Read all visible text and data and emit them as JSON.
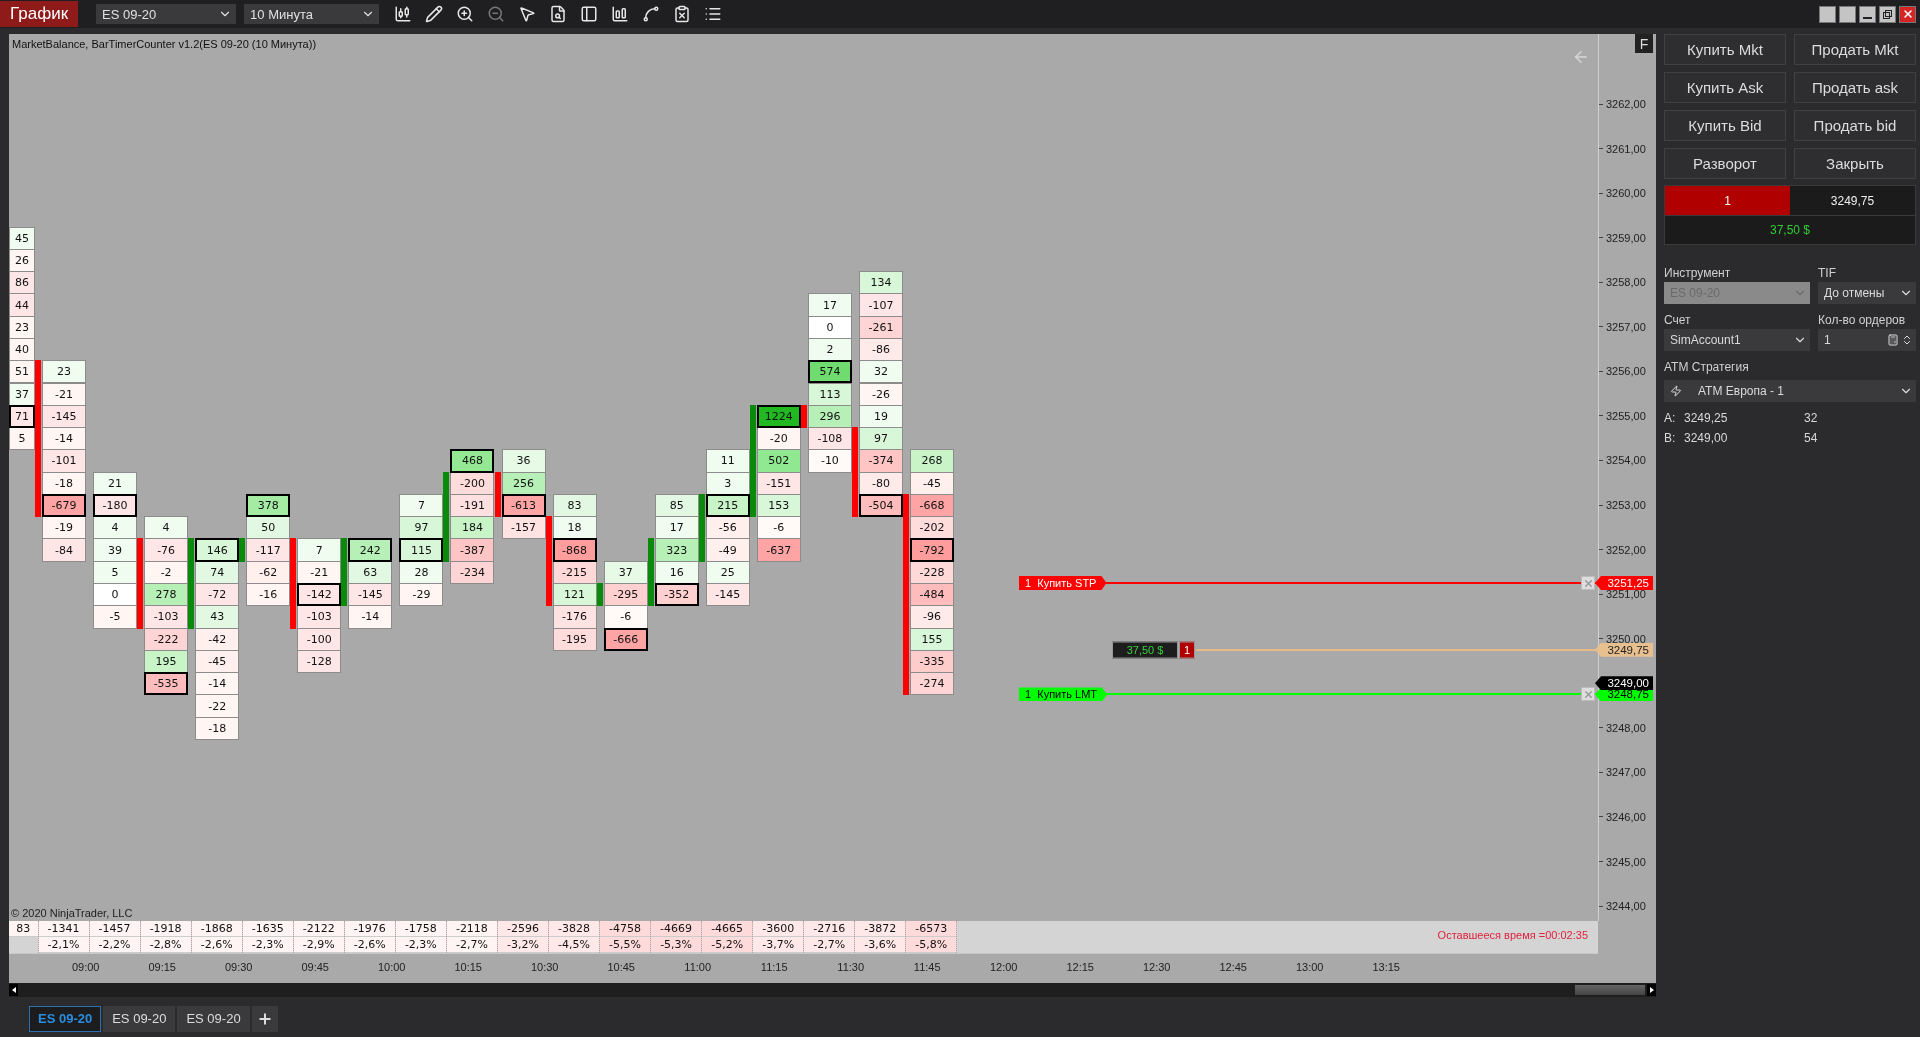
{
  "toolbar": {
    "title": "График",
    "instrument": "ES 09-20",
    "interval": "10 Минута"
  },
  "chart": {
    "indicator_label": "MarketBalance, BarTimerCounter v1.2(ES 09-20 (10 Минута))",
    "f_button": "F",
    "price_ticks": [
      "3262,00",
      "3261,00",
      "3260,00",
      "3259,00",
      "3258,00",
      "3257,00",
      "3256,00",
      "3255,00",
      "3254,00",
      "3253,00",
      "3252,00",
      "3251,00",
      "3250,00",
      "3248,00",
      "3247,00",
      "3246,00",
      "3245,00",
      "3244,00"
    ],
    "time_ticks": [
      "09:00",
      "09:15",
      "09:30",
      "09:45",
      "10:00",
      "10:15",
      "10:30",
      "10:45",
      "11:00",
      "11:15",
      "11:30",
      "11:45",
      "12:00",
      "12:15",
      "12:30",
      "12:45",
      "13:00",
      "13:15"
    ],
    "bars": [
      {
        "cells": [
          {
            "value": "45",
            "color": "#effcef",
            "max": false,
            "body": false
          },
          {
            "value": "26",
            "color": "#fff6f4",
            "max": false,
            "body": false
          },
          {
            "value": "86",
            "color": "#ffe6e6",
            "max": false,
            "body": false
          },
          {
            "value": "44",
            "color": "#ffe6e6",
            "max": false,
            "body": false
          },
          {
            "value": "23",
            "color": "#fff6f4",
            "max": false,
            "body": false
          },
          {
            "value": "40",
            "color": "#fff6f4",
            "max": false,
            "body": false
          },
          {
            "value": "51",
            "color": "#fff6f4",
            "max": false,
            "body": false
          },
          {
            "value": "37",
            "color": "#effcef",
            "max": false,
            "body": false
          },
          {
            "value": "71",
            "color": "#ffe6e6",
            "max": true,
            "body": false
          },
          {
            "value": "5",
            "color": "#fff6f4",
            "max": false,
            "body": false
          }
        ]
      },
      {
        "color": "#ff0000",
        "cells": [
          {
            "value": "23",
            "color": "#effcef",
            "max": false,
            "body": true
          },
          {
            "value": "-21",
            "color": "#fff6f4",
            "max": false,
            "body": true
          },
          {
            "value": "-145",
            "color": "#ffe6e6",
            "max": false,
            "body": true
          },
          {
            "value": "-14",
            "color": "#fff6f4",
            "max": false,
            "body": true
          },
          {
            "value": "-101",
            "color": "#ffe6e6",
            "max": false,
            "body": true
          },
          {
            "value": "-18",
            "color": "#fff6f4",
            "max": false,
            "body": true
          },
          {
            "value": "-679",
            "color": "#ffa4a4",
            "max": true,
            "body": true
          },
          {
            "value": "-19",
            "color": "#fff6f4",
            "max": false,
            "body": false
          },
          {
            "value": "-84",
            "color": "#ffe6e6",
            "max": false,
            "body": false
          }
        ]
      },
      {
        "cells": [
          {
            "value": "21",
            "color": "#effcef",
            "max": false,
            "body": false
          },
          {
            "value": "-180",
            "color": "#ffe6e6",
            "max": true,
            "body": false
          },
          {
            "value": "4",
            "color": "#effcef",
            "max": false,
            "body": false
          },
          {
            "value": "39",
            "color": "#effcef",
            "max": false,
            "body": false
          },
          {
            "value": "5",
            "color": "#effcef",
            "max": false,
            "body": false
          },
          {
            "value": "0",
            "color": "#ffffff",
            "max": false,
            "body": false
          },
          {
            "value": "-5",
            "color": "#fff6f4",
            "max": false,
            "body": false
          }
        ]
      },
      {
        "color": "#ff0000",
        "cells": [
          {
            "value": "4",
            "color": "#effcef",
            "max": false,
            "body": false
          },
          {
            "value": "-76",
            "color": "#ffe6e6",
            "max": false,
            "body": true
          },
          {
            "value": "-2",
            "color": "#fff6f4",
            "max": false,
            "body": true
          },
          {
            "value": "278",
            "color": "#b6f0b6",
            "max": false,
            "body": true
          },
          {
            "value": "-103",
            "color": "#ffe6e6",
            "max": false,
            "body": true
          },
          {
            "value": "-222",
            "color": "#ffd4d4",
            "max": false,
            "body": false
          },
          {
            "value": "195",
            "color": "#c8f4c8",
            "max": false,
            "body": false
          },
          {
            "value": "-535",
            "color": "#ffbcbc",
            "max": true,
            "body": false
          }
        ]
      },
      {
        "color": "#0a8a0a",
        "cells": [
          {
            "value": "146",
            "color": "#d8f6d8",
            "max": true,
            "body": true
          },
          {
            "value": "74",
            "color": "#e2f8e2",
            "max": false,
            "body": true
          },
          {
            "value": "-72",
            "color": "#ffe6e6",
            "max": false,
            "body": true
          },
          {
            "value": "43",
            "color": "#e2f8e2",
            "max": false,
            "body": true
          },
          {
            "value": "-42",
            "color": "#fff0ee",
            "max": false,
            "body": false
          },
          {
            "value": "-45",
            "color": "#fff0ee",
            "max": false,
            "body": false
          },
          {
            "value": "-14",
            "color": "#fff6f4",
            "max": false,
            "body": false
          },
          {
            "value": "-22",
            "color": "#fff6f4",
            "max": false,
            "body": false
          },
          {
            "value": "-18",
            "color": "#fff6f4",
            "max": false,
            "body": false
          }
        ]
      },
      {
        "color": "#0a8a0a",
        "cells": [
          {
            "value": "378",
            "color": "#a4eca4",
            "max": true,
            "body": false
          },
          {
            "value": "50",
            "color": "#e2f8e2",
            "max": false,
            "body": false
          },
          {
            "value": "-117",
            "color": "#ffe6e6",
            "max": false,
            "body": true
          },
          {
            "value": "-62",
            "color": "#fff0ee",
            "max": false,
            "body": false
          },
          {
            "value": "-16",
            "color": "#fff6f4",
            "max": false,
            "body": false
          }
        ]
      },
      {
        "color": "#ff0000",
        "cells": [
          {
            "value": "7",
            "color": "#effcef",
            "max": false,
            "body": true
          },
          {
            "value": "-21",
            "color": "#fff6f4",
            "max": false,
            "body": true
          },
          {
            "value": "-142",
            "color": "#ffe6e6",
            "max": true,
            "body": true
          },
          {
            "value": "-103",
            "color": "#ffe6e6",
            "max": false,
            "body": true
          },
          {
            "value": "-100",
            "color": "#ffe6e6",
            "max": false,
            "body": false
          },
          {
            "value": "-128",
            "color": "#ffe6e6",
            "max": false,
            "body": false
          }
        ]
      },
      {
        "color": "#0a8a0a",
        "cells": [
          {
            "value": "242",
            "color": "#b6f0b6",
            "max": true,
            "body": true
          },
          {
            "value": "63",
            "color": "#e2f8e2",
            "max": false,
            "body": true
          },
          {
            "value": "-145",
            "color": "#ffe6e6",
            "max": false,
            "body": true
          },
          {
            "value": "-14",
            "color": "#fff6f4",
            "max": false,
            "body": false
          }
        ]
      },
      {
        "cells": [
          {
            "value": "7",
            "color": "#effcef",
            "max": false,
            "body": false
          },
          {
            "value": "97",
            "color": "#d8f6d8",
            "max": false,
            "body": false
          },
          {
            "value": "115",
            "color": "#d8f6d8",
            "max": true,
            "body": false
          },
          {
            "value": "28",
            "color": "#effcef",
            "max": false,
            "body": false
          },
          {
            "value": "-29",
            "color": "#fff6f4",
            "max": false,
            "body": false
          }
        ]
      },
      {
        "color": "#0a8a0a",
        "cells": [
          {
            "value": "468",
            "color": "#94e894",
            "max": true,
            "body": false
          },
          {
            "value": "-200",
            "color": "#ffdcdc",
            "max": false,
            "body": true
          },
          {
            "value": "-191",
            "color": "#ffe0e0",
            "max": false,
            "body": true
          },
          {
            "value": "184",
            "color": "#c8f4c8",
            "max": false,
            "body": true
          },
          {
            "value": "-387",
            "color": "#ffc4c4",
            "max": false,
            "body": true
          },
          {
            "value": "-234",
            "color": "#ffd4d4",
            "max": false,
            "body": false
          }
        ]
      },
      {
        "color": "#ff0000",
        "cells": [
          {
            "value": "36",
            "color": "#e6fae6",
            "max": false,
            "body": false
          },
          {
            "value": "256",
            "color": "#b6f0b6",
            "max": false,
            "body": true
          },
          {
            "value": "-613",
            "color": "#ffa4a4",
            "max": true,
            "body": true
          },
          {
            "value": "-157",
            "color": "#ffe2e2",
            "max": false,
            "body": false
          }
        ]
      },
      {
        "color": "#ff0000",
        "cells": [
          {
            "value": "83",
            "color": "#e2f8e2",
            "max": false,
            "body": false
          },
          {
            "value": "18",
            "color": "#effcef",
            "max": false,
            "body": true
          },
          {
            "value": "-868",
            "color": "#ff9c9c",
            "max": true,
            "body": true
          },
          {
            "value": "-215",
            "color": "#ffd8d8",
            "max": false,
            "body": true
          },
          {
            "value": "121",
            "color": "#d8f6d8",
            "max": false,
            "body": true
          },
          {
            "value": "-176",
            "color": "#ffe2e2",
            "max": false,
            "body": false
          },
          {
            "value": "-195",
            "color": "#ffdcdc",
            "max": false,
            "body": false
          }
        ]
      },
      {
        "color": "#0a8a0a",
        "cells": [
          {
            "value": "37",
            "color": "#e6fae6",
            "max": false,
            "body": false
          },
          {
            "value": "-295",
            "color": "#ffd0d0",
            "max": false,
            "body": true
          },
          {
            "value": "-6",
            "color": "#fff9f8",
            "max": false,
            "body": false
          },
          {
            "value": "-666",
            "color": "#ffa4a4",
            "max": true,
            "body": false
          }
        ]
      },
      {
        "color": "#0a8a0a",
        "cells": [
          {
            "value": "85",
            "color": "#e2f8e2",
            "max": false,
            "body": false
          },
          {
            "value": "17",
            "color": "#effcef",
            "max": false,
            "body": false
          },
          {
            "value": "323",
            "color": "#b6f0b6",
            "max": false,
            "body": true
          },
          {
            "value": "16",
            "color": "#effcef",
            "max": false,
            "body": true
          },
          {
            "value": "-352",
            "color": "#ffd0d0",
            "max": true,
            "body": true
          }
        ]
      },
      {
        "color": "#0a8a0a",
        "cells": [
          {
            "value": "11",
            "color": "#effcef",
            "max": false,
            "body": false
          },
          {
            "value": "3",
            "color": "#effcef",
            "max": false,
            "body": false
          },
          {
            "value": "215",
            "color": "#c8f4c8",
            "max": true,
            "body": true
          },
          {
            "value": "-56",
            "color": "#fff0ee",
            "max": false,
            "body": true
          },
          {
            "value": "-49",
            "color": "#fff0ee",
            "max": false,
            "body": true
          },
          {
            "value": "25",
            "color": "#effcef",
            "max": false,
            "body": false
          },
          {
            "value": "-145",
            "color": "#ffe6e6",
            "max": false,
            "body": false
          }
        ]
      },
      {
        "color": "#0a8a0a",
        "cells": [
          {
            "value": "1224",
            "color": "#22b822",
            "max": true,
            "body": true
          },
          {
            "value": "-20",
            "color": "#fff6f4",
            "max": false,
            "body": true
          },
          {
            "value": "502",
            "color": "#90e890",
            "max": false,
            "body": true
          },
          {
            "value": "-151",
            "color": "#ffe6e6",
            "max": false,
            "body": true
          },
          {
            "value": "153",
            "color": "#d8f6d8",
            "max": false,
            "body": true
          },
          {
            "value": "-6",
            "color": "#fff9f8",
            "max": false,
            "body": false
          },
          {
            "value": "-637",
            "color": "#ffa4a4",
            "max": false,
            "body": false
          }
        ]
      },
      {
        "color": "#ff0000",
        "cells": [
          {
            "value": "17",
            "color": "#effcef",
            "max": false,
            "body": false
          },
          {
            "value": "0",
            "color": "#ffffff",
            "max": false,
            "body": false
          },
          {
            "value": "2",
            "color": "#effcef",
            "max": false,
            "body": false
          },
          {
            "value": "574",
            "color": "#70dc70",
            "max": true,
            "body": false
          },
          {
            "value": "113",
            "color": "#d8f6d8",
            "max": false,
            "body": false
          },
          {
            "value": "296",
            "color": "#b6f0b6",
            "max": false,
            "body": true
          },
          {
            "value": "-108",
            "color": "#ffe6e6",
            "max": false,
            "body": false
          },
          {
            "value": "-10",
            "color": "#fff9f8",
            "max": false,
            "body": false
          }
        ]
      },
      {
        "color": "#ff0000",
        "cells": [
          {
            "value": "134",
            "color": "#d8f6d8",
            "max": false,
            "body": false
          },
          {
            "value": "-107",
            "color": "#ffe6e6",
            "max": false,
            "body": false
          },
          {
            "value": "-261",
            "color": "#ffd4d4",
            "max": false,
            "body": false
          },
          {
            "value": "-86",
            "color": "#ffeaea",
            "max": false,
            "body": false
          },
          {
            "value": "32",
            "color": "#effcef",
            "max": false,
            "body": false
          },
          {
            "value": "-26",
            "color": "#fff6f4",
            "max": false,
            "body": false
          },
          {
            "value": "19",
            "color": "#effcef",
            "max": false,
            "body": false
          },
          {
            "value": "97",
            "color": "#d8f6d8",
            "max": false,
            "body": true
          },
          {
            "value": "-374",
            "color": "#ffc4c4",
            "max": false,
            "body": true
          },
          {
            "value": "-80",
            "color": "#ffeaea",
            "max": false,
            "body": true
          },
          {
            "value": "-504",
            "color": "#ffbcbc",
            "max": true,
            "body": true
          }
        ]
      },
      {
        "color": "#ff0000",
        "cells": [
          {
            "value": "268",
            "color": "#c8f4c8",
            "max": false,
            "body": false
          },
          {
            "value": "-45",
            "color": "#fff0ee",
            "max": false,
            "body": false
          },
          {
            "value": "-668",
            "color": "#ffa4a4",
            "max": false,
            "body": true
          },
          {
            "value": "-202",
            "color": "#ffdcdc",
            "max": false,
            "body": true
          },
          {
            "value": "-792",
            "color": "#ff9c9c",
            "max": true,
            "body": true
          },
          {
            "value": "-228",
            "color": "#ffd8d8",
            "max": false,
            "body": true
          },
          {
            "value": "-484",
            "color": "#ffbcbc",
            "max": false,
            "body": true
          },
          {
            "value": "-96",
            "color": "#ffeaea",
            "max": false,
            "body": true
          },
          {
            "value": "155",
            "color": "#d8f6d8",
            "max": false,
            "body": true
          },
          {
            "value": "-335",
            "color": "#ffcccc",
            "max": false,
            "body": true
          },
          {
            "value": "-274",
            "color": "#ffd4d4",
            "max": false,
            "body": true
          }
        ]
      }
    ],
    "footer": [
      {
        "delta": "83",
        "color": "#fff4f4"
      },
      {
        "delta": "-1341",
        "percent": "-2,1%",
        "color": "#fff4f4"
      },
      {
        "delta": "-1457",
        "percent": "-2,2%",
        "color": "#fff4f4"
      },
      {
        "delta": "-1918",
        "percent": "-2,8%",
        "color": "#fff4f4"
      },
      {
        "delta": "-1868",
        "percent": "-2,6%",
        "color": "#fff4f4"
      },
      {
        "delta": "-1635",
        "percent": "-2,3%",
        "color": "#fff4f4"
      },
      {
        "delta": "-2122",
        "percent": "-2,9%",
        "color": "#fff4f4"
      },
      {
        "delta": "-1976",
        "percent": "-2,6%",
        "color": "#fff4f4"
      },
      {
        "delta": "-1758",
        "percent": "-2,3%",
        "color": "#fff4f4"
      },
      {
        "delta": "-2118",
        "percent": "-2,7%",
        "color": "#fff4f4"
      },
      {
        "delta": "-2596",
        "percent": "-3,2%",
        "color": "#ffe8e8"
      },
      {
        "delta": "-3828",
        "percent": "-4,5%",
        "color": "#ffe8e8"
      },
      {
        "delta": "-4758",
        "percent": "-5,5%",
        "color": "#ffdada"
      },
      {
        "delta": "-4669",
        "percent": "-5,3%",
        "color": "#ffdada"
      },
      {
        "delta": "-4665",
        "percent": "-5,2%",
        "color": "#ffdada"
      },
      {
        "delta": "-3600",
        "percent": "-3,7%",
        "color": "#ffe8e8"
      },
      {
        "delta": "-2716",
        "percent": "-2,7%",
        "color": "#ffe8e8"
      },
      {
        "delta": "-3872",
        "percent": "-3,6%",
        "color": "#ffe8e8"
      },
      {
        "delta": "-6573",
        "percent": "-5,8%",
        "color": "#ffdada"
      }
    ],
    "copyright": "© 2020 NinjaTrader, LLC",
    "timer": "Оставшееся время =00:02:35",
    "orders": [
      {
        "kind": "stop",
        "label": "1  Купить STP",
        "price": "3251,25"
      },
      {
        "kind": "limit",
        "label": "1  Купить LMT",
        "price": "3248,75"
      }
    ],
    "position": {
      "color": "#b00000",
      "pnl": "37,50 $",
      "quantity": "1",
      "price": "3249,75"
    },
    "last_price": "3249,00"
  },
  "order_panel": {
    "buttons": [
      "Купить Mkt",
      "Продать Mkt",
      "Купить Ask",
      "Продать ask",
      "Купить Bid",
      "Продать bid",
      "Разворот",
      "Закрыть"
    ],
    "position": {
      "color": "#b00000",
      "quantity": "1",
      "price": "3249,75",
      "pnl": "37,50 $"
    },
    "instrument": {
      "label": "Инструмент",
      "value": "ES 09-20",
      "disabled": true
    },
    "tif": {
      "label": "TIF",
      "value": "До отмены"
    },
    "account": {
      "label": "Счет",
      "value": "SimAccount1"
    },
    "quantity": {
      "label": "Кол-во ордеров",
      "value": "1"
    },
    "atm": {
      "label": "ATM Стратегия",
      "value": "ATM Европа - 1"
    },
    "quotes": [
      {
        "side": "A:",
        "price": "3249,25",
        "size": "32"
      },
      {
        "side": "B:",
        "price": "3249,00",
        "size": "54"
      }
    ]
  },
  "tabs": [
    {
      "label": "ES 09-20",
      "selected": true
    },
    {
      "label": "ES 09-20",
      "selected": false
    },
    {
      "label": "ES 09-20",
      "selected": false
    }
  ]
}
